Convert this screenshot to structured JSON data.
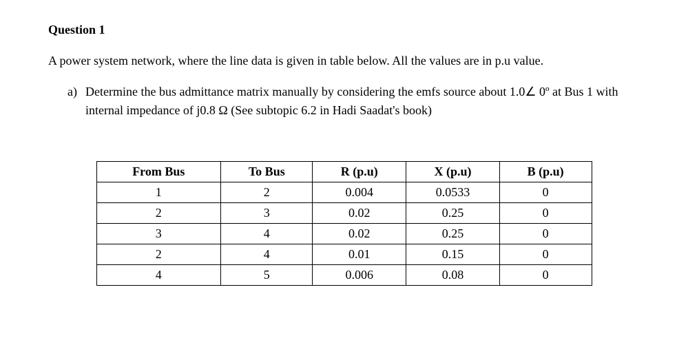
{
  "heading": "Question 1",
  "intro": "A power system network, where the line data is given in table below. All the values are in p.u value.",
  "part_a": {
    "label": "a)",
    "text": "Determine the bus admittance matrix manually by considering the emfs source about 1.0∠ 0º at Bus 1 with internal impedance of j0.8 Ω (See subtopic 6.2 in Hadi Saadat's book)"
  },
  "chart_data": {
    "type": "table",
    "headers": [
      "From Bus",
      "To Bus",
      "R (p.u)",
      "X (p.u)",
      "B (p.u)"
    ],
    "rows": [
      [
        "1",
        "2",
        "0.004",
        "0.0533",
        "0"
      ],
      [
        "2",
        "3",
        "0.02",
        "0.25",
        "0"
      ],
      [
        "3",
        "4",
        "0.02",
        "0.25",
        "0"
      ],
      [
        "2",
        "4",
        "0.01",
        "0.15",
        "0"
      ],
      [
        "4",
        "5",
        "0.006",
        "0.08",
        "0"
      ]
    ]
  }
}
